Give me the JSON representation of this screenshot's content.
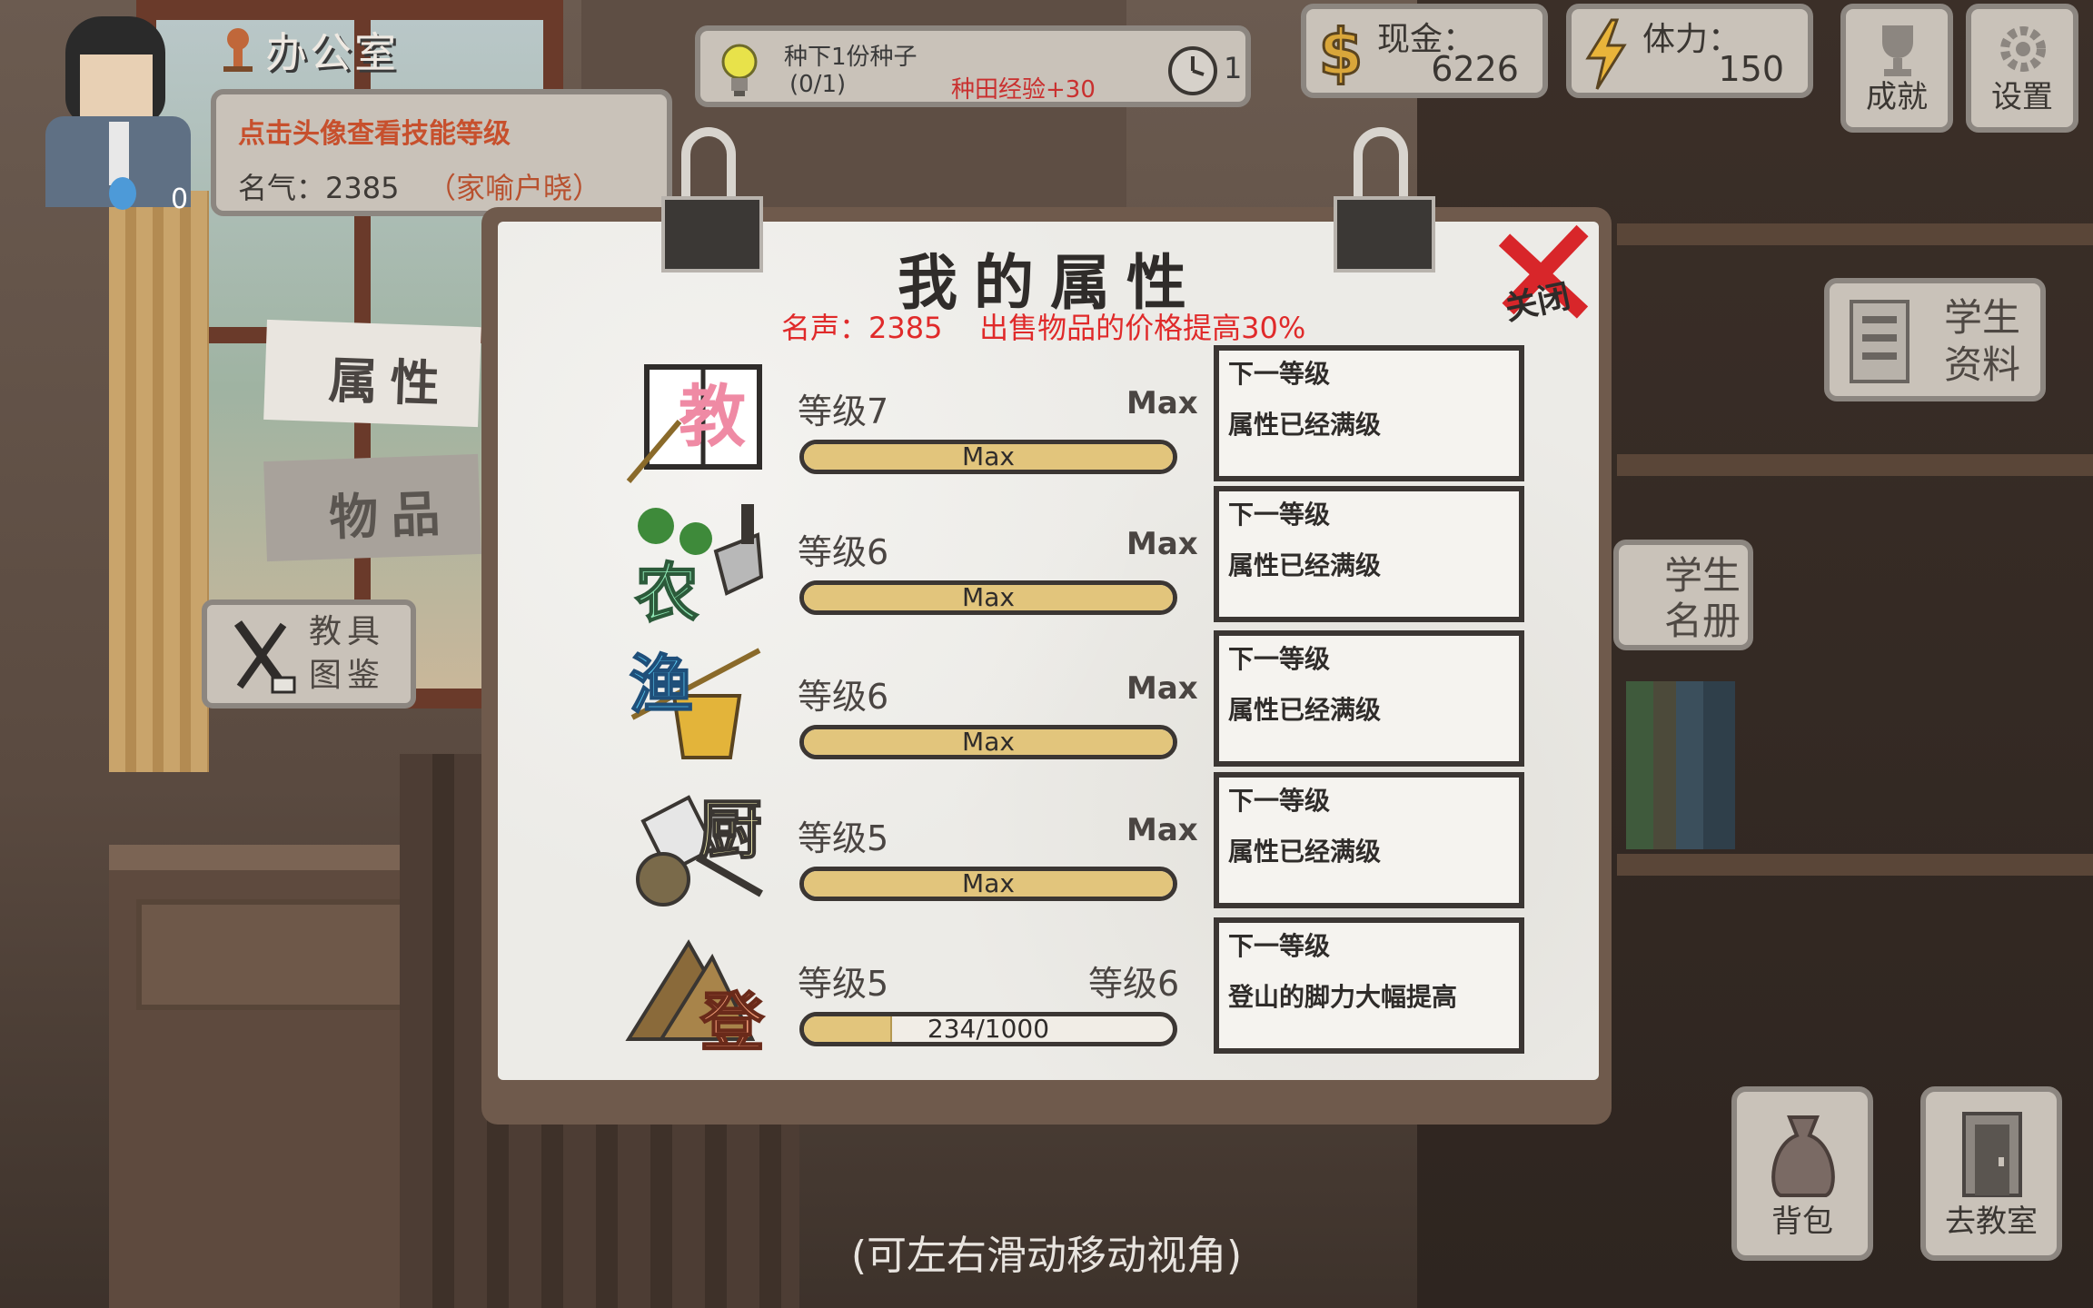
{
  "hud": {
    "location": "办公室",
    "hint": "点击头像查看技能等级",
    "fame_label": "名气：2385",
    "fame_title": "（家喻户晓）",
    "bulb_count": "0",
    "quest": {
      "title": "种下1份种子",
      "progress": "(0/1)",
      "reward": "种田经验+30",
      "count": "1"
    },
    "cash": {
      "label": "现金：",
      "value": "6226"
    },
    "stamina": {
      "label": "体力：",
      "value": "150"
    },
    "achievements_label": "成就",
    "settings_label": "设置"
  },
  "tabs": {
    "attributes": "属性",
    "items": "物品",
    "teaching_tools": [
      "教具",
      "图鉴"
    ]
  },
  "side": {
    "student_info": [
      "学生",
      "资料"
    ],
    "student_roster": [
      "学生",
      "名册"
    ]
  },
  "panel": {
    "title": "我的属性",
    "subtitle": "名声：2385    出售物品的价格提高30%",
    "close_label": "关闭",
    "skills": [
      {
        "icon_char": "教",
        "icon_name": "teaching-book-icon",
        "level": "等级7",
        "target": "Max",
        "bar_text": "Max",
        "progress": 1.0,
        "next_head": "下一等级",
        "next_body": "属性已经满级"
      },
      {
        "icon_char": "农",
        "icon_name": "farming-shovel-icon",
        "level": "等级6",
        "target": "Max",
        "bar_text": "Max",
        "progress": 1.0,
        "next_head": "下一等级",
        "next_body": "属性已经满级"
      },
      {
        "icon_char": "渔",
        "icon_name": "fishing-basket-icon",
        "level": "等级6",
        "target": "Max",
        "bar_text": "Max",
        "progress": 1.0,
        "next_head": "下一等级",
        "next_body": "属性已经满级"
      },
      {
        "icon_char": "厨",
        "icon_name": "cooking-cleaver-icon",
        "level": "等级5",
        "target": "Max",
        "bar_text": "Max",
        "progress": 1.0,
        "next_head": "下一等级",
        "next_body": "属性已经满级"
      },
      {
        "icon_char": "登",
        "icon_name": "climbing-mountain-icon",
        "level": "等级5",
        "target": "等级6",
        "bar_text": "234/1000",
        "progress": 0.234,
        "next_head": "下一等级",
        "next_body": "登山的脚力大幅提高"
      }
    ]
  },
  "bottom": {
    "bag_label": "背包",
    "classroom_label": "去教室",
    "swipe_hint": "(可左右滑动移动视角)"
  },
  "colors": {
    "accent_red": "#e02a2a",
    "hint_orange": "#c7502d",
    "bar_fill": "#e2c57c"
  }
}
